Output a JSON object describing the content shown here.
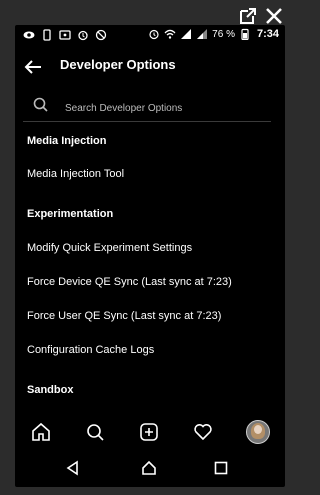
{
  "app_bar": {
    "title": "Developer Options"
  },
  "search": {
    "placeholder": "Search Developer Options"
  },
  "status_bar": {
    "battery_percent": "76 %",
    "time": "7:34"
  },
  "list": [
    {
      "label": "Media Injection",
      "type": "section"
    },
    {
      "label": "Media Injection Tool",
      "type": "item"
    },
    {
      "label": "Experimentation",
      "type": "section"
    },
    {
      "label": "Modify Quick Experiment Settings",
      "type": "item"
    },
    {
      "label": "Force Device QE Sync (Last sync at 7:23)",
      "type": "item"
    },
    {
      "label": "Force User QE Sync (Last sync at 7:23)",
      "type": "item"
    },
    {
      "label": "Configuration Cache Logs",
      "type": "item"
    },
    {
      "label": "Sandbox",
      "type": "section"
    }
  ],
  "bottom_nav": [
    "home-icon",
    "search-icon",
    "add-post-icon",
    "activity-heart-icon",
    "profile-avatar"
  ],
  "system_nav": [
    "back-icon",
    "home-icon",
    "recents-icon"
  ],
  "colors": {
    "background": "#000000",
    "text": "#ffffff",
    "frame": "#2c2c2c"
  }
}
